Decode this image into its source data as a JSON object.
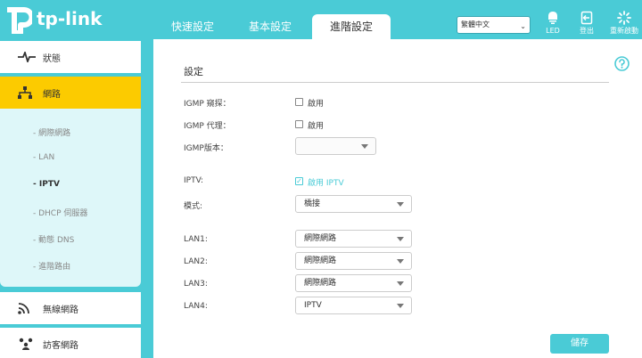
{
  "brand": {
    "name": "tp-link"
  },
  "tabs": [
    {
      "label": "快速設定",
      "active": false
    },
    {
      "label": "基本設定",
      "active": false
    },
    {
      "label": "進階設定",
      "active": true
    }
  ],
  "header": {
    "language": "繁體中文",
    "led_label": "LED",
    "logout_label": "登出",
    "reboot_label": "重新啟動"
  },
  "sidebar": {
    "items": [
      {
        "label": "狀態",
        "icon": "pulse-icon"
      },
      {
        "label": "網路",
        "icon": "network-icon",
        "active": true
      },
      {
        "label": "無線網路",
        "icon": "wifi-icon"
      },
      {
        "label": "訪客網路",
        "icon": "guests-icon"
      }
    ],
    "subitems": [
      {
        "label": "網際網路"
      },
      {
        "label": "LAN"
      },
      {
        "label": "IPTV",
        "active": true
      },
      {
        "label": "DHCP 伺服器"
      },
      {
        "label": "動態 DNS"
      },
      {
        "label": "進階路由"
      }
    ]
  },
  "form": {
    "title": "設定",
    "igmp_snooping": {
      "label": "IGMP 窺探：",
      "option": "啟用",
      "checked": false
    },
    "igmp_proxy": {
      "label": "IGMP 代理：",
      "option": "啟用",
      "checked": false
    },
    "igmp_version": {
      "label": "IGMP版本：",
      "value": ""
    },
    "iptv": {
      "label": "IPTV:",
      "option": "啟用 IPTV",
      "checked": true
    },
    "mode": {
      "label": "模式:",
      "value": "橋接"
    },
    "lan1": {
      "label": "LAN1:",
      "value": "網際網路"
    },
    "lan2": {
      "label": "LAN2:",
      "value": "網際網路"
    },
    "lan3": {
      "label": "LAN3:",
      "value": "網際網路"
    },
    "lan4": {
      "label": "LAN4:",
      "value": "IPTV"
    },
    "save_label": "儲存"
  },
  "colors": {
    "accent": "#4acbd6",
    "active_menu": "#fccb00",
    "submenu_bg": "#def7f9"
  }
}
